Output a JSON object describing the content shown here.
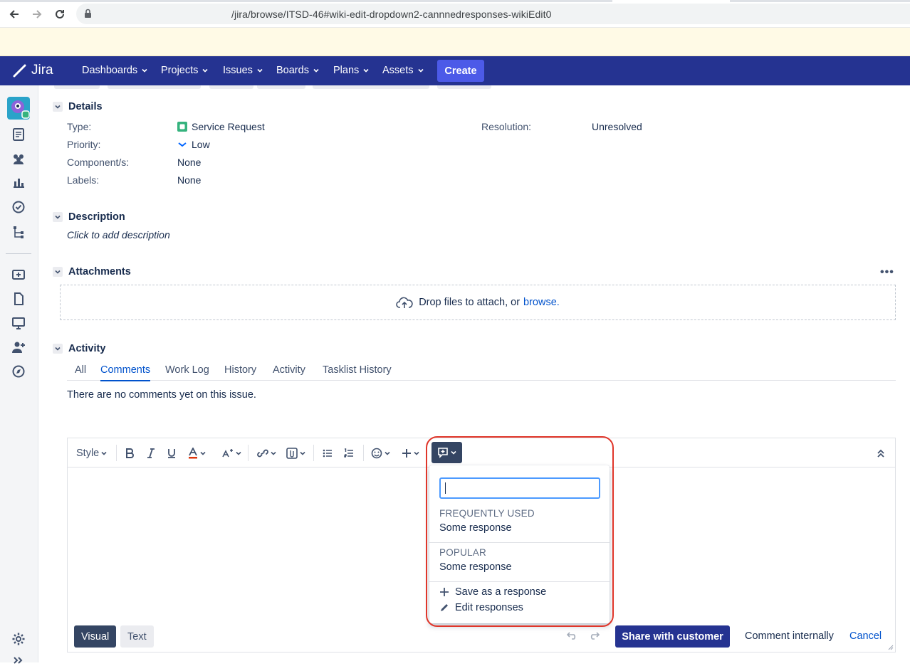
{
  "browser": {
    "url": "/jira/browse/ITSD-46#wiki-edit-dropdown2-cannnedresponses-wikiEdit0"
  },
  "topnav": {
    "logo_text": "Jira",
    "items": [
      "Dashboards",
      "Projects",
      "Issues",
      "Boards",
      "Plans",
      "Assets"
    ],
    "create_label": "Create",
    "bg_color": "#253391"
  },
  "details": {
    "heading": "Details",
    "type_label": "Type:",
    "type_value": "Service Request",
    "priority_label": "Priority:",
    "priority_value": "Low",
    "components_label": "Component/s:",
    "components_value": "None",
    "labels_label": "Labels:",
    "labels_value": "None",
    "resolution_label": "Resolution:",
    "resolution_value": "Unresolved"
  },
  "description": {
    "heading": "Description",
    "placeholder": "Click to add description"
  },
  "attachments": {
    "heading": "Attachments",
    "more": "•••",
    "drop_text": "Drop files to attach, or",
    "browse_link": "browse."
  },
  "activity": {
    "heading": "Activity",
    "tabs": [
      "All",
      "Comments",
      "Work Log",
      "History",
      "Activity",
      "Tasklist History"
    ],
    "active_tab": "Comments",
    "empty_text": "There are no comments yet on this issue."
  },
  "editor": {
    "style_label": "Style",
    "mode_visual": "Visual",
    "mode_text": "Text",
    "share_button": "Share with customer",
    "internal_button": "Comment internally",
    "cancel_button": "Cancel"
  },
  "canned_dropdown": {
    "search_value": "",
    "frequent_heading": "FREQUENTLY USED",
    "frequent_item": "Some response",
    "popular_heading": "POPULAR",
    "popular_item": "Some response",
    "save_action": "Save as a response",
    "edit_action": "Edit responses"
  },
  "colors": {
    "accent": "#0052cc",
    "highlight": "#e0362a",
    "primary_button": "#253391"
  }
}
